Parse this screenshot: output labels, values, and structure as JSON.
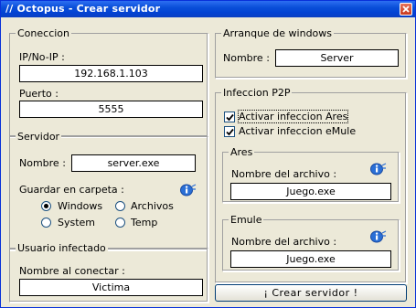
{
  "window": {
    "title": "// Octopus - Crear servidor",
    "close_icon": "close-icon",
    "titlebar_color": "#0a4fd8"
  },
  "conexion": {
    "legend": "Coneccion",
    "ip_label": "IP/No-IP :",
    "ip_value": "192.168.1.103",
    "port_label": "Puerto :",
    "port_value": "5555"
  },
  "servidor": {
    "legend": "Servidor",
    "name_label": "Nombre :",
    "name_value": "server.exe",
    "save_label": "Guardar en carpeta :",
    "options": [
      "Windows",
      "Archivos",
      "System",
      "Temp"
    ],
    "selected": "Windows"
  },
  "usuario": {
    "legend": "Usuario infectado",
    "connect_label": "Nombre al conectar :",
    "connect_value": "Victima"
  },
  "arranque": {
    "legend": "Arranque de windows",
    "name_label": "Nombre :",
    "name_value": "Server"
  },
  "p2p": {
    "legend": "Infeccion P2P",
    "ares_check": "Activar infeccion Ares",
    "ares_checked": true,
    "emule_check": "Activar infeccion eMule",
    "emule_checked": true,
    "ares": {
      "legend": "Ares",
      "file_label": "Nombre del archivo :",
      "file_value": "Juego.exe"
    },
    "emule": {
      "legend": "Emule",
      "file_label": "Nombre del archivo :",
      "file_value": "Juego.exe"
    }
  },
  "create_button": "¡ Crear servidor !"
}
